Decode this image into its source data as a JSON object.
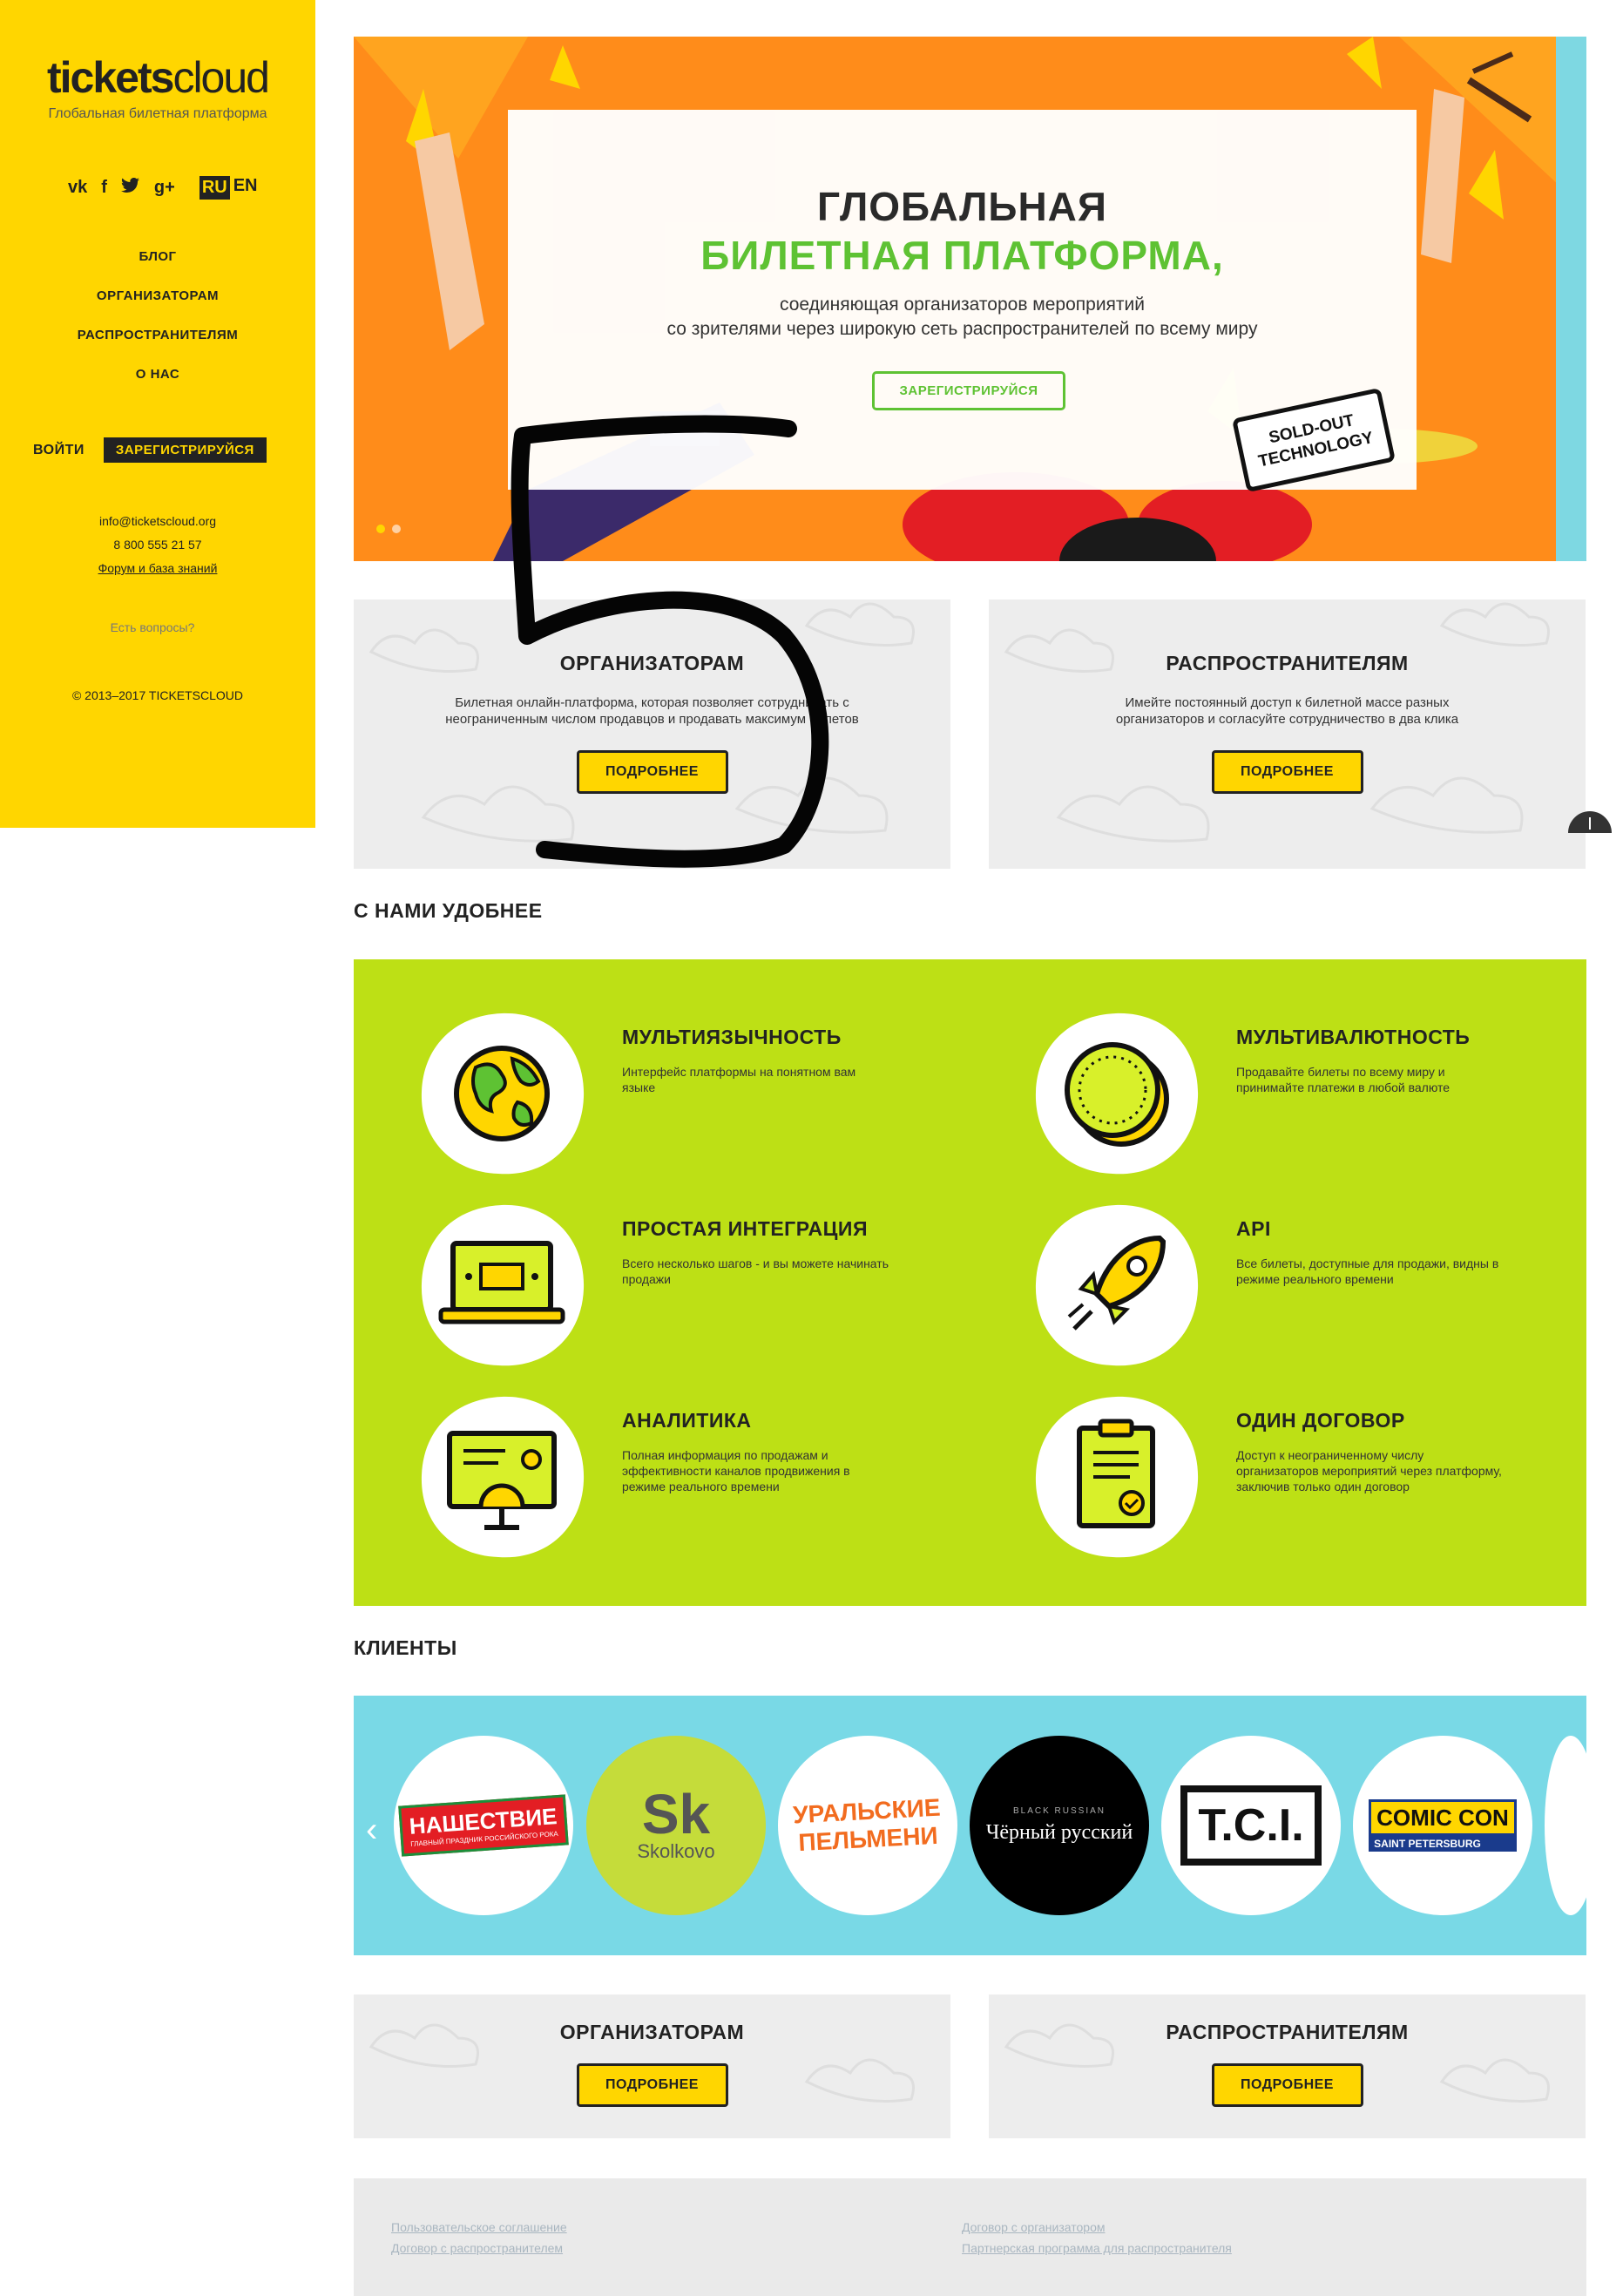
{
  "sidebar": {
    "logo_bold": "tickets",
    "logo_light": "cloud",
    "tagline": "Глобальная билетная платформа",
    "social_icons": [
      "vk-icon",
      "facebook-icon",
      "twitter-icon",
      "google-plus-icon"
    ],
    "lang_active": "RU",
    "lang_other": "EN",
    "nav": [
      "БЛОГ",
      "ОРГАНИЗАТОРАМ",
      "РАСПРОСТРАНИТЕЛЯМ",
      "О НАС"
    ],
    "login_label": "ВОЙТИ",
    "register_label": "ЗАРЕГИСТРИРУЙСЯ",
    "email": "info@ticketscloud.org",
    "phone": "8 800 555 21 57",
    "forum_link": "Форум и база знаний",
    "question": "Есть вопросы?",
    "copyright": "© 2013–2017 TICKETSCLOUD",
    "color": "#ffd600"
  },
  "hero": {
    "title_line1": "ГЛОБАЛЬНАЯ",
    "title_line2": "БИЛЕТНАЯ ПЛАТФОРМА,",
    "subtitle_line1": "соединяющая организаторов мероприятий",
    "subtitle_line2": "со зрителями через широкую сеть распространителей по всему миру",
    "button_label": "ЗАРЕГИСТРИРУЙСЯ",
    "stamp_line1": "SOLD-OUT",
    "stamp_line2": "TECHNOLOGY",
    "accent_color": "#5ec233",
    "background_color": "#ff8c1a"
  },
  "audience_top": [
    {
      "title": "ОРГАНИЗАТОРАМ",
      "text_line1": "Билетная онлайн-платформа, которая позволяет сотрудничать с",
      "text_line2": "неограниченным числом продавцов и продавать максимум билетов",
      "button": "ПОДРОБНЕЕ"
    },
    {
      "title": "РАСПРОСТРАНИТЕЛЯМ",
      "text_line1": "Имейте постоянный доступ к билетной массе разных",
      "text_line2": "организаторов и согласуйте сотрудничество в два клика",
      "button": "ПОДРОБНЕЕ"
    }
  ],
  "features_title": "С НАМИ УДОБНЕЕ",
  "features": [
    {
      "icon": "globe-icon",
      "title": "МУЛЬТИЯЗЫЧНОСТЬ",
      "text": "Интерфейс платформы на понятном вам языке"
    },
    {
      "icon": "coin-icon",
      "title": "МУЛЬТИВАЛЮТНОСТЬ",
      "text": "Продавайте билеты по всему миру и принимайте платежи в любой валюте"
    },
    {
      "icon": "laptop-ticket-icon",
      "title": "ПРОСТАЯ ИНТЕГРАЦИЯ",
      "text": "Всего несколько шагов - и вы можете начинать продажи"
    },
    {
      "icon": "rocket-icon",
      "title": "API",
      "text": "Все билеты, доступные для продажи, видны в режиме реального времени"
    },
    {
      "icon": "analytics-monitor-icon",
      "title": "АНАЛИТИКА",
      "text": "Полная информация по продажам и эффективности каналов продвижения в режиме реального времени"
    },
    {
      "icon": "contract-clipboard-icon",
      "title": "ОДИН ДОГОВОР",
      "text": "Доступ к неограниченному числу организаторов мероприятий через платформу, заключив только один договор"
    }
  ],
  "features_color": "#bde015",
  "clients_title": "КЛИЕНТЫ",
  "clients": [
    {
      "name": "НАШЕСТВИЕ",
      "sub": "ГЛАВНЫЙ ПРАЗДНИК РОССИЙСКОГО РОКА"
    },
    {
      "name": "Sk",
      "sub": "Skolkovo"
    },
    {
      "name": "УРАЛЬСКИЕ",
      "sub": "ПЕЛЬМЕНИ"
    },
    {
      "name": "BLACK RUSSIAN",
      "sub": "Чёрный русский"
    },
    {
      "name": "T.C.I.",
      "sub": ""
    },
    {
      "name": "COMIC CON",
      "sub": "SAINT PETERSBURG"
    }
  ],
  "clients_color": "#79d9e6",
  "audience_bottom": [
    {
      "title": "ОРГАНИЗАТОРАМ",
      "button": "ПОДРОБНЕЕ"
    },
    {
      "title": "РАСПРОСТРАНИТЕЛЯМ",
      "button": "ПОДРОБНЕЕ"
    }
  ],
  "footer": {
    "links": [
      "Пользовательское соглашение",
      "Договор с распространителем",
      "Договор с организатором",
      "Партнерская программа для распространителя"
    ]
  }
}
